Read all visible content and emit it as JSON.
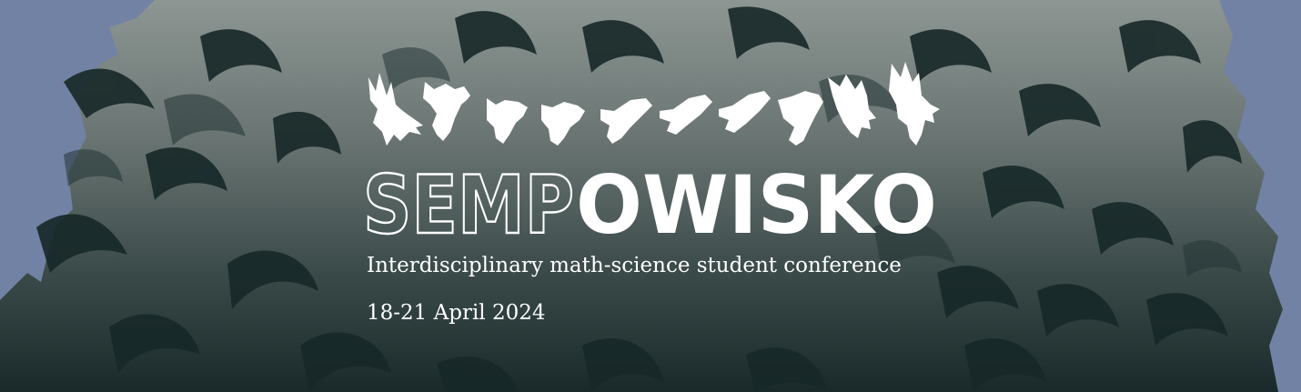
{
  "banner": {
    "title_outline": "SEMP",
    "title_solid": "OWISKO",
    "subtitle": "Interdisciplinary math-science student conference",
    "dates": "18-21 April 2024"
  },
  "colors": {
    "sky": "#7182a4",
    "fog_light": "#7d8785",
    "fog_dark": "#1e2d2d",
    "forest_shadow": "#172828",
    "text": "#ffffff"
  },
  "icons": [
    "eagle-flight-sequence-icon"
  ]
}
